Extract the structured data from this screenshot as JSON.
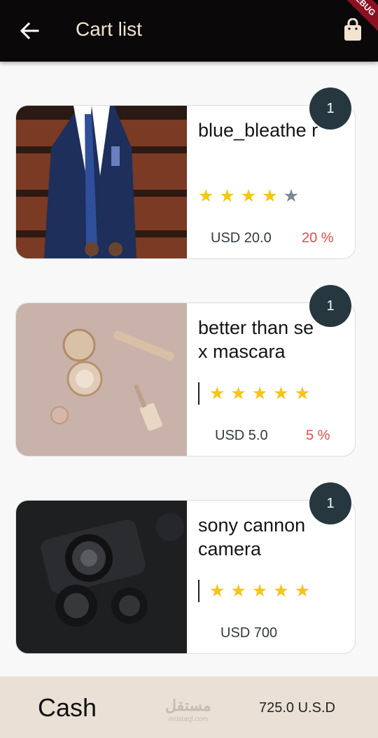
{
  "appbar": {
    "title": "Cart list",
    "back_icon": "arrow-left-icon",
    "cart_icon": "shopping-bag-icon",
    "debug_banner": "DEBUG",
    "background": "#0a0808",
    "title_color": "#f3e4cf"
  },
  "items": [
    {
      "name": "blue_bleathe r",
      "rating": 4,
      "max_rating": 5,
      "price": "USD 20.0",
      "discount": "20 %",
      "quantity": "1",
      "image": "man in navy suit photo"
    },
    {
      "name": "better than sex mascara",
      "rating": 5,
      "max_rating": 5,
      "price": "USD 5.0",
      "discount": "5 %",
      "quantity": "1",
      "image": "cosmetics flat lay photo"
    },
    {
      "name": "sony cannon camera",
      "rating": 5,
      "max_rating": 5,
      "price": "USD 700",
      "discount": "",
      "quantity": "1",
      "image": "dark camera photo"
    }
  ],
  "footer": {
    "payment_label": "Cash",
    "total": "725.0  U.S.D",
    "watermark": "مستقل",
    "watermark_sub": "mostaql.com",
    "background": "#ebe0d5"
  },
  "colors": {
    "badge": "#263740",
    "star_on": "#f5c518",
    "star_off": "#7b8793",
    "discount": "#e44d4d"
  }
}
